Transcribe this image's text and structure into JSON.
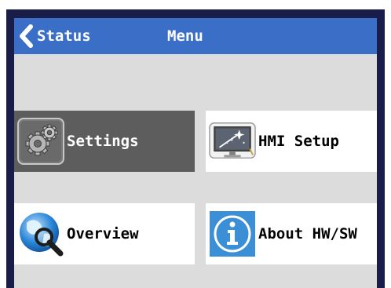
{
  "header": {
    "back_label": "Status",
    "title": "Menu",
    "back_icon": "chevron-left-icon"
  },
  "tiles": [
    {
      "label": "Settings",
      "icon": "gears-icon",
      "selected": true
    },
    {
      "label": "HMI Setup",
      "icon": "monitor-setup-icon",
      "selected": false
    },
    {
      "label": "Overview",
      "icon": "globe-magnifier-icon",
      "selected": false
    },
    {
      "label": "About HW/SW",
      "icon": "info-icon",
      "selected": false
    }
  ],
  "colors": {
    "frame": "#1b1d49",
    "header": "#3a6ec7",
    "background": "#dcdcdc",
    "selected_tile": "#5d5d5d",
    "tile": "#ffffff",
    "info_blue": "#3b8fd6"
  }
}
